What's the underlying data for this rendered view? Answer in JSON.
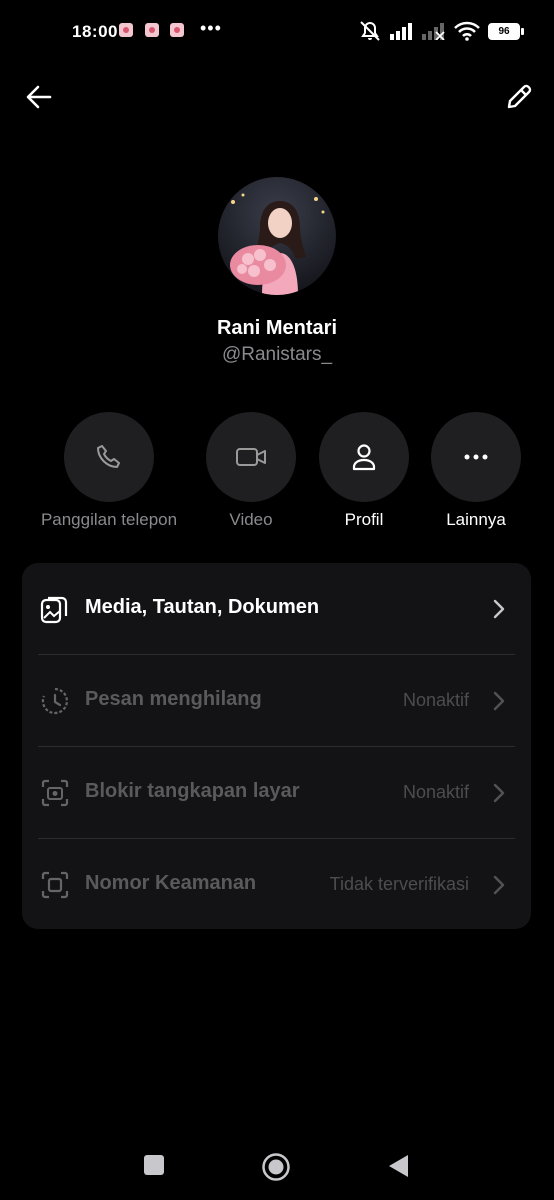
{
  "status_bar": {
    "time": "18:00",
    "more": "•••",
    "battery": "96"
  },
  "header": {
    "back_icon": "arrow-left-icon",
    "edit_icon": "pencil-icon"
  },
  "profile": {
    "name": "Rani Mentari",
    "handle": "@Ranistars_"
  },
  "actions": [
    {
      "label": "Panggilan telepon",
      "icon": "phone-icon",
      "enabled": false
    },
    {
      "label": "Video",
      "icon": "video-icon",
      "enabled": false
    },
    {
      "label": "Profil",
      "icon": "person-icon",
      "enabled": true
    },
    {
      "label": "Lainnya",
      "icon": "more-icon",
      "enabled": true
    }
  ],
  "settings": [
    {
      "title": "Media, Tautan, Dokumen",
      "value": "",
      "icon": "media-icon"
    },
    {
      "title": "Pesan menghilang",
      "value": "Nonaktif",
      "icon": "timer-icon"
    },
    {
      "title": "Blokir tangkapan layar",
      "value": "Nonaktif",
      "icon": "screenshot-icon"
    },
    {
      "title": "Nomor Keamanan",
      "value": "Tidak terverifikasi",
      "icon": "security-icon"
    }
  ],
  "colors": {
    "background": "#000000",
    "card": "#131315",
    "button": "#1f1f21",
    "muted_text": "#8a8a8e"
  }
}
